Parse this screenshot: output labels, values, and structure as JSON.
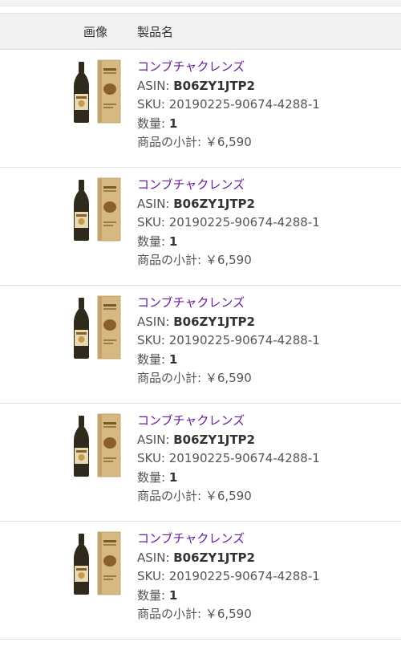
{
  "table": {
    "header": {
      "image_col": "画像",
      "name_col": "製品名"
    },
    "labels": {
      "asin": "ASIN: ",
      "sku": "SKU: ",
      "qty": "数量: ",
      "subtotal": "商品の小計: "
    },
    "items": [
      {
        "name": "コンブチャクレンズ",
        "asin": "B06ZY1JTP2",
        "sku": "20190225-90674-4288-1",
        "qty": "1",
        "subtotal": "￥6,590"
      },
      {
        "name": "コンブチャクレンズ",
        "asin": "B06ZY1JTP2",
        "sku": "20190225-90674-4288-1",
        "qty": "1",
        "subtotal": "￥6,590"
      },
      {
        "name": "コンブチャクレンズ",
        "asin": "B06ZY1JTP2",
        "sku": "20190225-90674-4288-1",
        "qty": "1",
        "subtotal": "￥6,590"
      },
      {
        "name": "コンブチャクレンズ",
        "asin": "B06ZY1JTP2",
        "sku": "20190225-90674-4288-1",
        "qty": "1",
        "subtotal": "￥6,590"
      },
      {
        "name": "コンブチャクレンズ",
        "asin": "B06ZY1JTP2",
        "sku": "20190225-90674-4288-1",
        "qty": "1",
        "subtotal": "￥6,590"
      }
    ]
  },
  "colors": {
    "link": "#6a1b9a",
    "header_bg": "#f1f1f1",
    "bottle": "#2f2a1c",
    "box": "#d6b982"
  },
  "icons": {
    "product_image": "kombucha-bottle-and-box-image"
  }
}
